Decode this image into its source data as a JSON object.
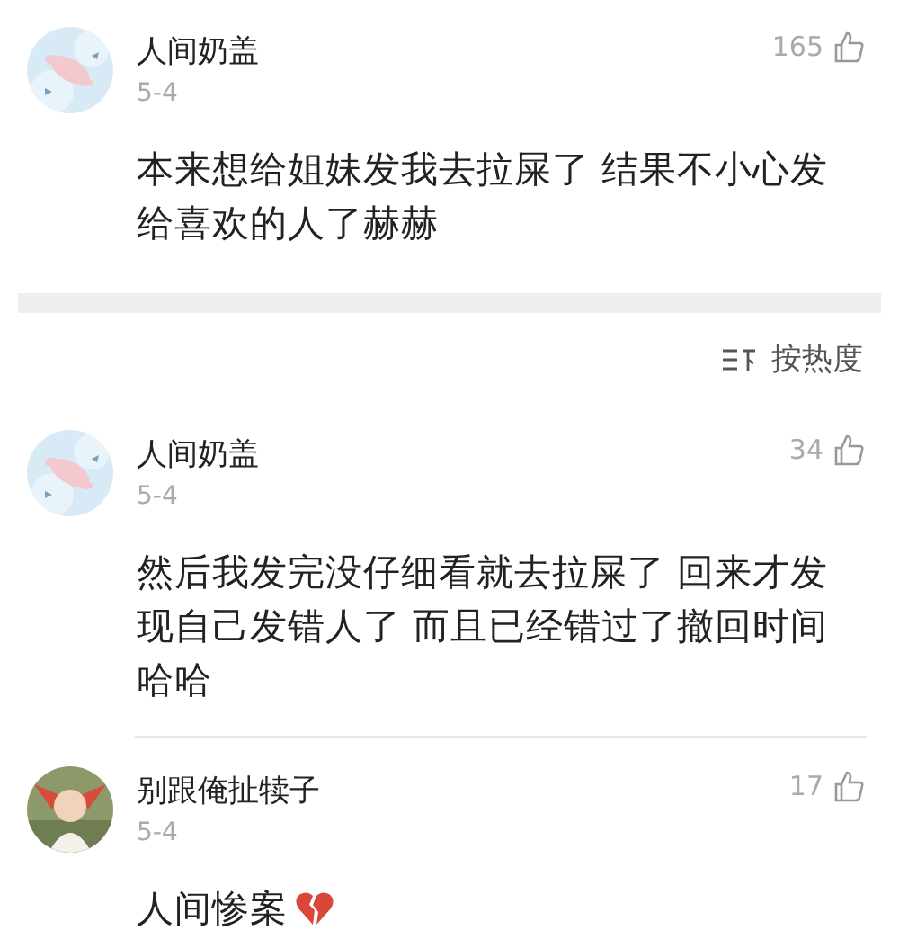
{
  "top_comment": {
    "name": "人间奶盖",
    "date": "5-4",
    "likes": "165",
    "kind": "plain",
    "text": "本来想给姐妹发我去拉屎了 结果不小心发给喜欢的人了赫赫"
  },
  "sort_button": {
    "label": "按热度"
  },
  "comments": [
    {
      "name": "人间奶盖",
      "date": "5-4",
      "likes": "34",
      "kind": "plain",
      "text": "然后我发完没仔细看就去拉屎了 回来才发现自己发错人了 而且已经错过了撤回时间哈哈"
    },
    {
      "name": "别跟俺扯犊子",
      "date": "5-4",
      "likes": "17",
      "kind": "text_with_icon",
      "text": "人间惨案"
    }
  ]
}
